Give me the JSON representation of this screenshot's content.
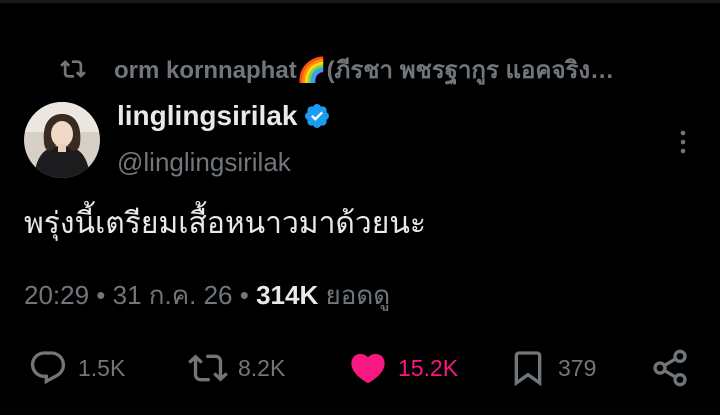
{
  "repost": {
    "icon": "repost-icon",
    "text": "orm kornnaphat🌈(ภีรชา พชรฐากูร แอคจริง…"
  },
  "author": {
    "display_name": "linglingsirilak",
    "handle": "@linglingsirilak",
    "verified_icon": "verified-badge-icon",
    "verified_color": "#1d9bf0"
  },
  "tweet": {
    "text": "พรุ่งนี้เตรียมเสื้อหนาวมาด้วยนะ"
  },
  "meta": {
    "time": "20:29",
    "separator": " • ",
    "date": "31 ก.ค. 26",
    "views_count": "314K",
    "views_label": "ยอดดู"
  },
  "actions": {
    "reply_count": "1.5K",
    "repost_count": "8.2K",
    "like_count": "15.2K",
    "bookmark_count": "379",
    "like_color": "#f91880",
    "muted_color": "#71767b"
  }
}
